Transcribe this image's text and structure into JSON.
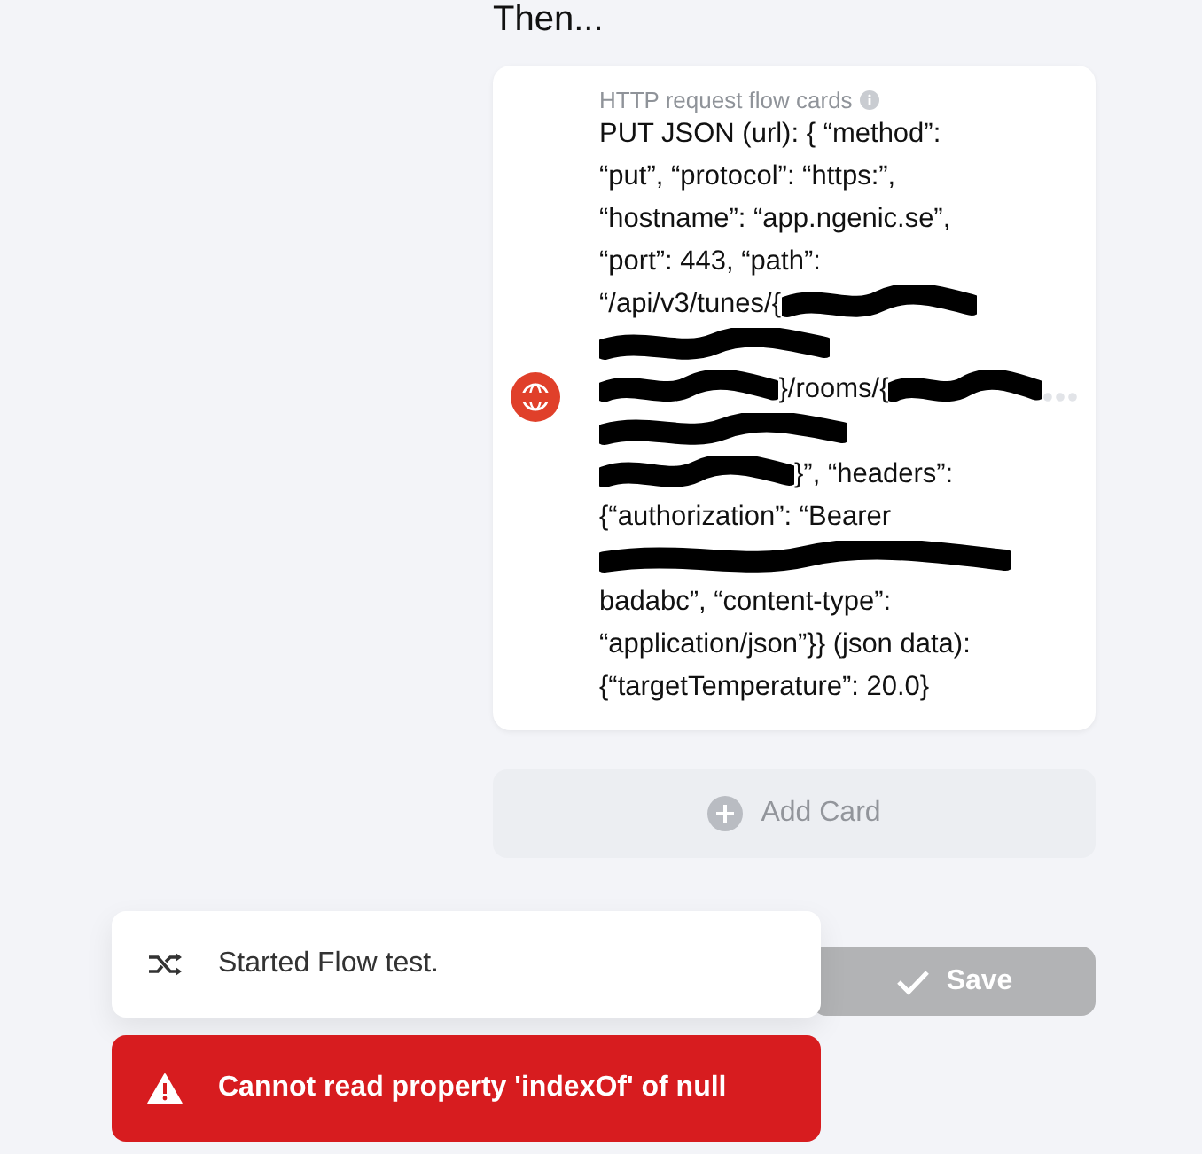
{
  "section_heading": "Then...",
  "action_card": {
    "category": "HTTP request flow cards",
    "lines": [
      [
        {
          "kind": "text",
          "text": "PUT JSON (url): { “method”:"
        }
      ],
      [
        {
          "kind": "text",
          "text": "“put”, “protocol”: “https:”,"
        }
      ],
      [
        {
          "kind": "text",
          "text": "“hostname”: “app.ngenic.se”,"
        }
      ],
      [
        {
          "kind": "text",
          "text": "“port”: 443, “path”:"
        }
      ],
      [
        {
          "kind": "text",
          "text": "“/api/v3/tunes/{"
        },
        {
          "kind": "redacted"
        }
      ],
      [
        {
          "kind": "redacted"
        }
      ],
      [
        {
          "kind": "redacted"
        },
        {
          "kind": "text",
          "text": "}/rooms/{"
        },
        {
          "kind": "redacted"
        }
      ],
      [
        {
          "kind": "redacted"
        }
      ],
      [
        {
          "kind": "redacted"
        },
        {
          "kind": "text",
          "text": "}”, “headers”:"
        }
      ],
      [
        {
          "kind": "text",
          "text": "{“authorization”: “Bearer"
        }
      ],
      [
        {
          "kind": "redacted"
        }
      ],
      [
        {
          "kind": "text",
          "text": "badabc”, “content-type”:"
        }
      ],
      [
        {
          "kind": "text",
          "text": "“application/json”}} (json data):"
        }
      ],
      [
        {
          "kind": "text",
          "text": "{“targetTemperature”: 20.0}"
        }
      ]
    ]
  },
  "add_card_button": {
    "label": "Add Card"
  },
  "save_button": {
    "label": "Save",
    "disabled": true
  },
  "toasts": [
    {
      "kind": "info",
      "message": "Started Flow test."
    },
    {
      "kind": "error",
      "message": "Cannot read property 'indexOf' of null"
    }
  ]
}
